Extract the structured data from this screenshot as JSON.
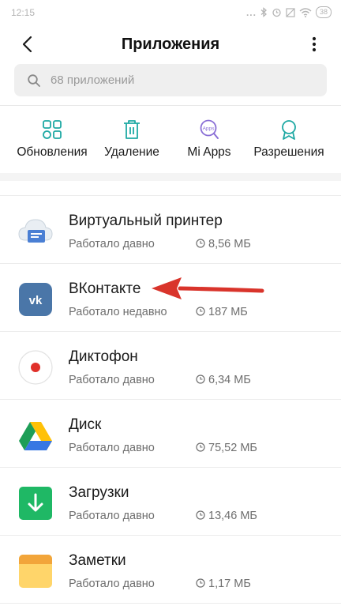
{
  "status_bar": {
    "time": "12:15",
    "dots": "...",
    "battery": "38"
  },
  "header": {
    "title": "Приложения"
  },
  "search": {
    "placeholder": "68 приложений"
  },
  "actions": [
    {
      "label": "Обновления",
      "icon": "updates-grid-icon"
    },
    {
      "label": "Удаление",
      "icon": "trash-icon"
    },
    {
      "label": "Mi Apps",
      "icon": "mi-apps-icon"
    },
    {
      "label": "Разрешения",
      "icon": "permissions-ribbon-icon"
    }
  ],
  "apps": [
    {
      "name": "Виртуальный принтер",
      "status": "Работало давно",
      "size": "8,56 МБ",
      "icon": "virtual-printer-icon"
    },
    {
      "name": "ВКонтакте",
      "status": "Работало недавно",
      "size": "187 МБ",
      "icon": "vk-icon"
    },
    {
      "name": "Диктофон",
      "status": "Работало давно",
      "size": "6,34 МБ",
      "icon": "recorder-icon"
    },
    {
      "name": "Диск",
      "status": "Работало давно",
      "size": "75,52 МБ",
      "icon": "google-drive-icon"
    },
    {
      "name": "Загрузки",
      "status": "Работало давно",
      "size": "13,46 МБ",
      "icon": "downloads-icon"
    },
    {
      "name": "Заметки",
      "status": "Работало давно",
      "size": "1,17 МБ",
      "icon": "notes-icon"
    }
  ],
  "colors": {
    "accent": "#1fa9a4",
    "arrow": "#d9342b",
    "vk": "#4a76a8"
  }
}
